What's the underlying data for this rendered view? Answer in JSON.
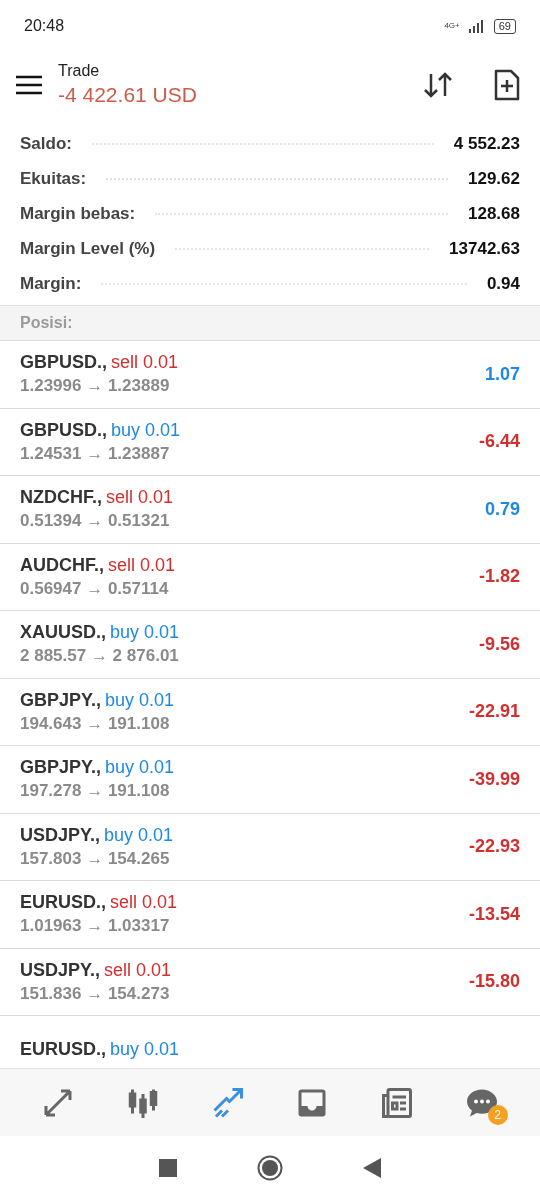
{
  "status_bar": {
    "time": "20:48",
    "network": "4G+",
    "battery": "69"
  },
  "header": {
    "title": "Trade",
    "amount": "-4 422.61 USD"
  },
  "summary": [
    {
      "label": "Saldo:",
      "value": "4 552.23"
    },
    {
      "label": "Ekuitas:",
      "value": "129.62"
    },
    {
      "label": "Margin bebas:",
      "value": "128.68"
    },
    {
      "label": "Margin Level (%)",
      "value": "13742.63"
    },
    {
      "label": "Margin:",
      "value": "0.94"
    }
  ],
  "positions_heading": "Posisi:",
  "positions": [
    {
      "symbol": "GBPUSD.,",
      "is_sell": true,
      "action": "sell 0.01",
      "prices": "1.23996 → 1.23889",
      "profit": "1.07",
      "gain": true
    },
    {
      "symbol": "GBPUSD.,",
      "is_sell": false,
      "action": "buy 0.01",
      "prices": "1.24531 → 1.23887",
      "profit": "-6.44",
      "gain": false
    },
    {
      "symbol": "NZDCHF.,",
      "is_sell": true,
      "action": "sell 0.01",
      "prices": "0.51394 → 0.51321",
      "profit": "0.79",
      "gain": true
    },
    {
      "symbol": "AUDCHF.,",
      "is_sell": true,
      "action": "sell 0.01",
      "prices": "0.56947 → 0.57114",
      "profit": "-1.82",
      "gain": false
    },
    {
      "symbol": "XAUUSD.,",
      "is_sell": false,
      "action": "buy 0.01",
      "prices": "2 885.57 → 2 876.01",
      "profit": "-9.56",
      "gain": false
    },
    {
      "symbol": "GBPJPY.,",
      "is_sell": false,
      "action": "buy 0.01",
      "prices": "194.643 → 191.108",
      "profit": "-22.91",
      "gain": false
    },
    {
      "symbol": "GBPJPY.,",
      "is_sell": false,
      "action": "buy 0.01",
      "prices": "197.278 → 191.108",
      "profit": "-39.99",
      "gain": false
    },
    {
      "symbol": "USDJPY.,",
      "is_sell": false,
      "action": "buy 0.01",
      "prices": "157.803 → 154.265",
      "profit": "-22.93",
      "gain": false
    },
    {
      "symbol": "EURUSD.,",
      "is_sell": true,
      "action": "sell 0.01",
      "prices": "1.01963 → 1.03317",
      "profit": "-13.54",
      "gain": false
    },
    {
      "symbol": "USDJPY.,",
      "is_sell": true,
      "action": "sell 0.01",
      "prices": "151.836 → 154.273",
      "profit": "-15.80",
      "gain": false
    },
    {
      "symbol": "EURUSD.,",
      "is_sell": false,
      "action": "buy 0.01"
    }
  ],
  "bottom_nav": [
    {
      "kind": "quotes",
      "selected": false
    },
    {
      "kind": "chart",
      "selected": false
    },
    {
      "kind": "trade",
      "selected": true
    },
    {
      "kind": "history",
      "selected": false
    },
    {
      "kind": "news",
      "selected": false
    },
    {
      "kind": "messages",
      "selected": false,
      "badge": "2"
    }
  ]
}
